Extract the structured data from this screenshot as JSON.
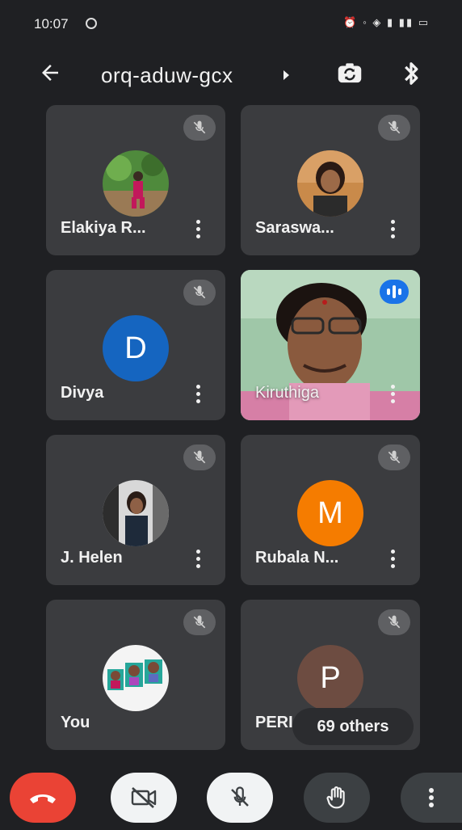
{
  "status_bar": {
    "time": "10:07",
    "icons_text": "⏰ ◦ ◈ ▮ ▮▮ ▭"
  },
  "header": {
    "meeting_code": "orq-aduw-gcx"
  },
  "participants": [
    {
      "name": "Elakiya R...",
      "avatar_type": "photo",
      "muted": true
    },
    {
      "name": "Saraswa...",
      "avatar_type": "photo",
      "muted": true
    },
    {
      "name": "Divya",
      "avatar_type": "letter",
      "letter": "D",
      "color": "#1565c0",
      "muted": true
    },
    {
      "name": "Kiruthiga",
      "avatar_type": "video",
      "muted": false,
      "speaking": true
    },
    {
      "name": "J. Helen",
      "avatar_type": "photo",
      "muted": true
    },
    {
      "name": "Rubala N...",
      "avatar_type": "letter",
      "letter": "M",
      "color": "#f57c00",
      "muted": true
    },
    {
      "name": "You",
      "avatar_type": "photo",
      "muted": true
    },
    {
      "name": "PERI",
      "avatar_type": "letter",
      "letter": "P",
      "color": "#6d4c41",
      "muted": true
    }
  ],
  "others_label": "69 others",
  "colors": {
    "background": "#1f2023",
    "tile": "#3b3c3f",
    "end_call": "#ea4335",
    "speaking": "#1a73e8"
  },
  "controls": [
    {
      "icon": "end-call-icon"
    },
    {
      "icon": "camera-off-icon"
    },
    {
      "icon": "mic-off-icon"
    },
    {
      "icon": "raise-hand-icon"
    },
    {
      "icon": "more-options-icon"
    }
  ]
}
